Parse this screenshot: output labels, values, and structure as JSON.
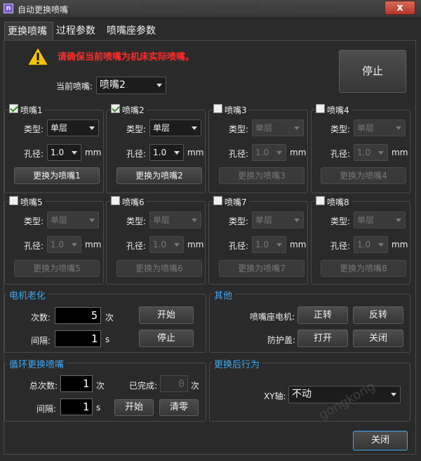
{
  "window": {
    "title": "自动更换喷嘴",
    "close": "x"
  },
  "tabs": [
    "更换喷嘴",
    "过程参数",
    "喷嘴座参数"
  ],
  "warning": "请确保当前喷嘴为机床实际喷嘴。",
  "current": {
    "label": "当前喷嘴:",
    "value": "喷嘴2"
  },
  "stop_main": "停止",
  "nozzles": [
    {
      "name": "喷嘴1",
      "checked": true,
      "type_label": "类型:",
      "type": "单层",
      "bore_label": "孔径:",
      "bore": "1.0",
      "unit": "mm",
      "button": "更换为喷嘴1"
    },
    {
      "name": "喷嘴2",
      "checked": true,
      "type_label": "类型:",
      "type": "单层",
      "bore_label": "孔径:",
      "bore": "1.0",
      "unit": "mm",
      "button": "更换为喷嘴2"
    },
    {
      "name": "喷嘴3",
      "checked": false,
      "type_label": "类型:",
      "type": "单层",
      "bore_label": "孔径:",
      "bore": "1.0",
      "unit": "mm",
      "button": "更换为喷嘴3"
    },
    {
      "name": "喷嘴4",
      "checked": false,
      "type_label": "类型:",
      "type": "单层",
      "bore_label": "孔径:",
      "bore": "1.0",
      "unit": "mm",
      "button": "更换为喷嘴4"
    },
    {
      "name": "喷嘴5",
      "checked": false,
      "type_label": "类型:",
      "type": "单层",
      "bore_label": "孔径:",
      "bore": "1.0",
      "unit": "mm",
      "button": "更换为喷嘴5"
    },
    {
      "name": "喷嘴6",
      "checked": false,
      "type_label": "类型:",
      "type": "单层",
      "bore_label": "孔径:",
      "bore": "1.0",
      "unit": "mm",
      "button": "更换为喷嘴6"
    },
    {
      "name": "喷嘴7",
      "checked": false,
      "type_label": "类型:",
      "type": "单层",
      "bore_label": "孔径:",
      "bore": "1.0",
      "unit": "mm",
      "button": "更换为喷嘴7"
    },
    {
      "name": "喷嘴8",
      "checked": false,
      "type_label": "类型:",
      "type": "单层",
      "bore_label": "孔径:",
      "bore": "1.0",
      "unit": "mm",
      "button": "更换为喷嘴8"
    }
  ],
  "motor_aging": {
    "title": "电机老化",
    "count_label": "次数:",
    "count": "5",
    "count_unit": "次",
    "interval_label": "间隔:",
    "interval": "1",
    "interval_unit": "s",
    "start": "开始",
    "stop": "停止"
  },
  "other": {
    "title": "其他",
    "motor_label": "喷嘴座电机:",
    "forward": "正转",
    "reverse": "反转",
    "cover_label": "防护盖:",
    "open": "打开",
    "close": "关闭"
  },
  "cycle": {
    "title": "循环更换喷嘴",
    "total_label": "总次数:",
    "total": "1",
    "total_unit": "次",
    "done_label": "已完成:",
    "done": "0",
    "done_unit": "次",
    "interval_label": "间隔:",
    "interval": "1",
    "interval_unit": "s",
    "start": "开始",
    "clear": "清零"
  },
  "after": {
    "title": "更换后行为",
    "xy_label": "XY轴:",
    "xy_value": "不动"
  },
  "close_button": "关闭",
  "watermark": "gongkong",
  "colors": {
    "accent_blue": "#3fa9f5",
    "warning_red": "#ff2b2b",
    "close_red": "#c0392b"
  }
}
